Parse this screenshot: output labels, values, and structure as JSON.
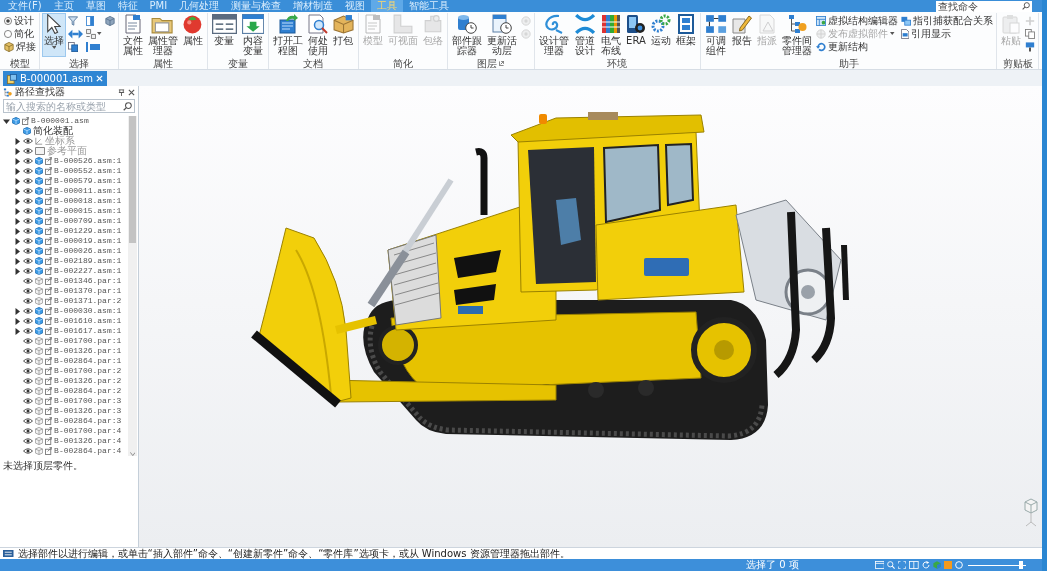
{
  "menu_tabs": [
    {
      "label": "文件(F)",
      "selected": false
    },
    {
      "label": "主页",
      "selected": false
    },
    {
      "label": "草图",
      "selected": false
    },
    {
      "label": "特征",
      "selected": false
    },
    {
      "label": "PMI",
      "selected": false
    },
    {
      "label": "几何处理",
      "selected": false
    },
    {
      "label": "测量与检查",
      "selected": false
    },
    {
      "label": "增材制造",
      "selected": false
    },
    {
      "label": "视图",
      "selected": false
    },
    {
      "label": "工具",
      "selected": true
    },
    {
      "label": "智能工具",
      "selected": false
    }
  ],
  "command_search": {
    "placeholder": "查找命令"
  },
  "ribbon": {
    "groups": [
      {
        "label": "模型",
        "items": [
          {
            "kind": "radio",
            "label": "设计",
            "selected": true
          },
          {
            "kind": "radio",
            "label": "简化",
            "selected": false
          },
          {
            "kind": "small",
            "label": "焊接",
            "disabled": false
          }
        ]
      },
      {
        "label": "选择",
        "items": [
          {
            "kind": "large",
            "label": "选择",
            "active": true,
            "disabled": false,
            "dropdown": true
          },
          {
            "kind": "icon",
            "disabled": false
          },
          {
            "kind": "icon",
            "disabled": false
          },
          {
            "kind": "icon",
            "disabled": false
          },
          {
            "kind": "icon",
            "disabled": false
          },
          {
            "kind": "icon",
            "disabled": false,
            "dropdown": true
          },
          {
            "kind": "icon",
            "disabled": false
          },
          {
            "kind": "icon",
            "disabled": false
          }
        ]
      },
      {
        "label": "属性",
        "items": [
          {
            "kind": "large",
            "label": "文件属性",
            "active": false,
            "disabled": false
          },
          {
            "kind": "large",
            "label": "属性管理器",
            "active": false,
            "disabled": false
          },
          {
            "kind": "large",
            "label": "属性",
            "active": false,
            "disabled": false
          }
        ]
      },
      {
        "label": "变量",
        "items": [
          {
            "kind": "large",
            "label": "变量",
            "active": false,
            "disabled": false
          },
          {
            "kind": "large",
            "label": "内容变量",
            "active": false,
            "disabled": false
          }
        ]
      },
      {
        "label": "文档",
        "items": [
          {
            "kind": "large",
            "label": "打开工程图",
            "active": false,
            "disabled": false
          },
          {
            "kind": "large",
            "label": "何处使用",
            "active": false,
            "disabled": false
          },
          {
            "kind": "large",
            "label": "打包",
            "active": false,
            "disabled": false
          }
        ]
      },
      {
        "label": "简化",
        "items": [
          {
            "kind": "large",
            "label": "模型",
            "active": false,
            "disabled": true
          },
          {
            "kind": "large",
            "label": "可视面",
            "active": false,
            "disabled": true
          },
          {
            "kind": "large",
            "label": "包络",
            "active": false,
            "disabled": true
          }
        ]
      },
      {
        "label": "图层",
        "launcher": true,
        "items": [
          {
            "kind": "large",
            "label": "部件跟踪器",
            "active": false,
            "disabled": false
          },
          {
            "kind": "large",
            "label": "更新活动层",
            "active": false,
            "disabled": false
          },
          {
            "kind": "icon",
            "disabled": true
          },
          {
            "kind": "icon",
            "disabled": true
          }
        ]
      },
      {
        "label": "环境",
        "items": [
          {
            "kind": "large",
            "label": "设计管理器",
            "active": false,
            "disabled": false
          },
          {
            "kind": "large",
            "label": "管道设计",
            "active": false,
            "disabled": false
          },
          {
            "kind": "large",
            "label": "电气布线",
            "active": false,
            "disabled": false
          },
          {
            "kind": "large",
            "label": "ERA",
            "active": false,
            "disabled": false
          },
          {
            "kind": "large",
            "label": "运动",
            "active": false,
            "disabled": false
          },
          {
            "kind": "large",
            "label": "框架",
            "active": false,
            "disabled": false
          }
        ]
      },
      {
        "label": "助手",
        "items": [
          {
            "kind": "large",
            "label": "可调组件",
            "active": false,
            "disabled": false
          },
          {
            "kind": "large",
            "label": "报告",
            "active": false,
            "disabled": false
          },
          {
            "kind": "large",
            "label": "指派",
            "active": false,
            "disabled": true
          },
          {
            "kind": "large",
            "label": "零件间管理器",
            "active": false,
            "disabled": false
          },
          {
            "kind": "small",
            "label": "虚拟结构编辑器",
            "disabled": false
          },
          {
            "kind": "small",
            "label": "发布虚拟部件",
            "disabled": true,
            "dropdown": true
          },
          {
            "kind": "small",
            "label": "更新结构",
            "disabled": false
          },
          {
            "kind": "small",
            "label": "指引捕获配合关系",
            "disabled": false
          },
          {
            "kind": "small",
            "label": "引用显示",
            "disabled": false
          }
        ]
      },
      {
        "label": "剪贴板",
        "items": [
          {
            "kind": "large",
            "label": "粘贴",
            "active": false,
            "disabled": true
          },
          {
            "kind": "icon",
            "disabled": true
          },
          {
            "kind": "icon",
            "disabled": false
          },
          {
            "kind": "icon",
            "disabled": false
          }
        ]
      }
    ]
  },
  "document_tabs": [
    {
      "label": "B-000001.asm",
      "selected": true
    }
  ],
  "pathfinder": {
    "title": "路径查找器",
    "search": {
      "placeholder": "输入搜索的名称或类型"
    },
    "tree": [
      {
        "kind": "assembly",
        "label": "B-000001.asm",
        "expanded": true,
        "children": [
          {
            "kind": "simplified",
            "label": "简化装配"
          },
          {
            "kind": "coordinate",
            "label": "坐标系",
            "expanded": false
          },
          {
            "kind": "plane",
            "label": "参考平面",
            "expanded": false
          },
          {
            "kind": "assembly",
            "label": "B-000526.asm:1",
            "expanded": false
          },
          {
            "kind": "assembly",
            "label": "B-000552.asm:1",
            "expanded": false
          },
          {
            "kind": "assembly",
            "label": "B-000579.asm:1",
            "expanded": false
          },
          {
            "kind": "assembly",
            "label": "B-000011.asm:1",
            "expanded": false
          },
          {
            "kind": "assembly",
            "label": "B-000018.asm:1",
            "expanded": false
          },
          {
            "kind": "assembly",
            "label": "B-000015.asm:1",
            "expanded": false
          },
          {
            "kind": "assembly",
            "label": "B-000709.asm:1",
            "expanded": false
          },
          {
            "kind": "assembly",
            "label": "B-001229.asm:1",
            "expanded": false
          },
          {
            "kind": "assembly",
            "label": "B-000019.asm:1",
            "expanded": false
          },
          {
            "kind": "assembly",
            "label": "B-000026.asm:1",
            "expanded": false
          },
          {
            "kind": "assembly",
            "label": "B-002189.asm:1",
            "expanded": false
          },
          {
            "kind": "assembly",
            "label": "B-002227.asm:1",
            "expanded": false
          },
          {
            "kind": "part",
            "label": "B-001346.par:1"
          },
          {
            "kind": "part",
            "label": "B-001370.par:1"
          },
          {
            "kind": "part",
            "label": "B-001371.par:2"
          },
          {
            "kind": "assembly",
            "label": "B-000030.asm:1",
            "expanded": false
          },
          {
            "kind": "assembly",
            "label": "B-001610.asm:1",
            "expanded": false
          },
          {
            "kind": "assembly",
            "label": "B-001617.asm:1",
            "expanded": false
          },
          {
            "kind": "part",
            "label": "B-001700.par:1"
          },
          {
            "kind": "part",
            "label": "B-001326.par:1"
          },
          {
            "kind": "part",
            "label": "B-002864.par:1"
          },
          {
            "kind": "part",
            "label": "B-001700.par:2"
          },
          {
            "kind": "part",
            "label": "B-001326.par:2"
          },
          {
            "kind": "part",
            "label": "B-002864.par:2"
          },
          {
            "kind": "part",
            "label": "B-001700.par:3"
          },
          {
            "kind": "part",
            "label": "B-001326.par:3"
          },
          {
            "kind": "part",
            "label": "B-002864.par:3"
          },
          {
            "kind": "part",
            "label": "B-001700.par:4"
          },
          {
            "kind": "part",
            "label": "B-001326.par:4"
          },
          {
            "kind": "part",
            "label": "B-002864.par:4"
          }
        ]
      }
    ],
    "message": "未选择顶层零件。"
  },
  "prompt": "选择部件以进行编辑，或单击“插入部件”命令、“创建新零件”命令、“零件库”选项卡，或从 Windows 资源管理器拖出部件。",
  "status_bar": {
    "selection": "选择了 0 项",
    "zoom_slider": {
      "level": 0.92
    }
  }
}
